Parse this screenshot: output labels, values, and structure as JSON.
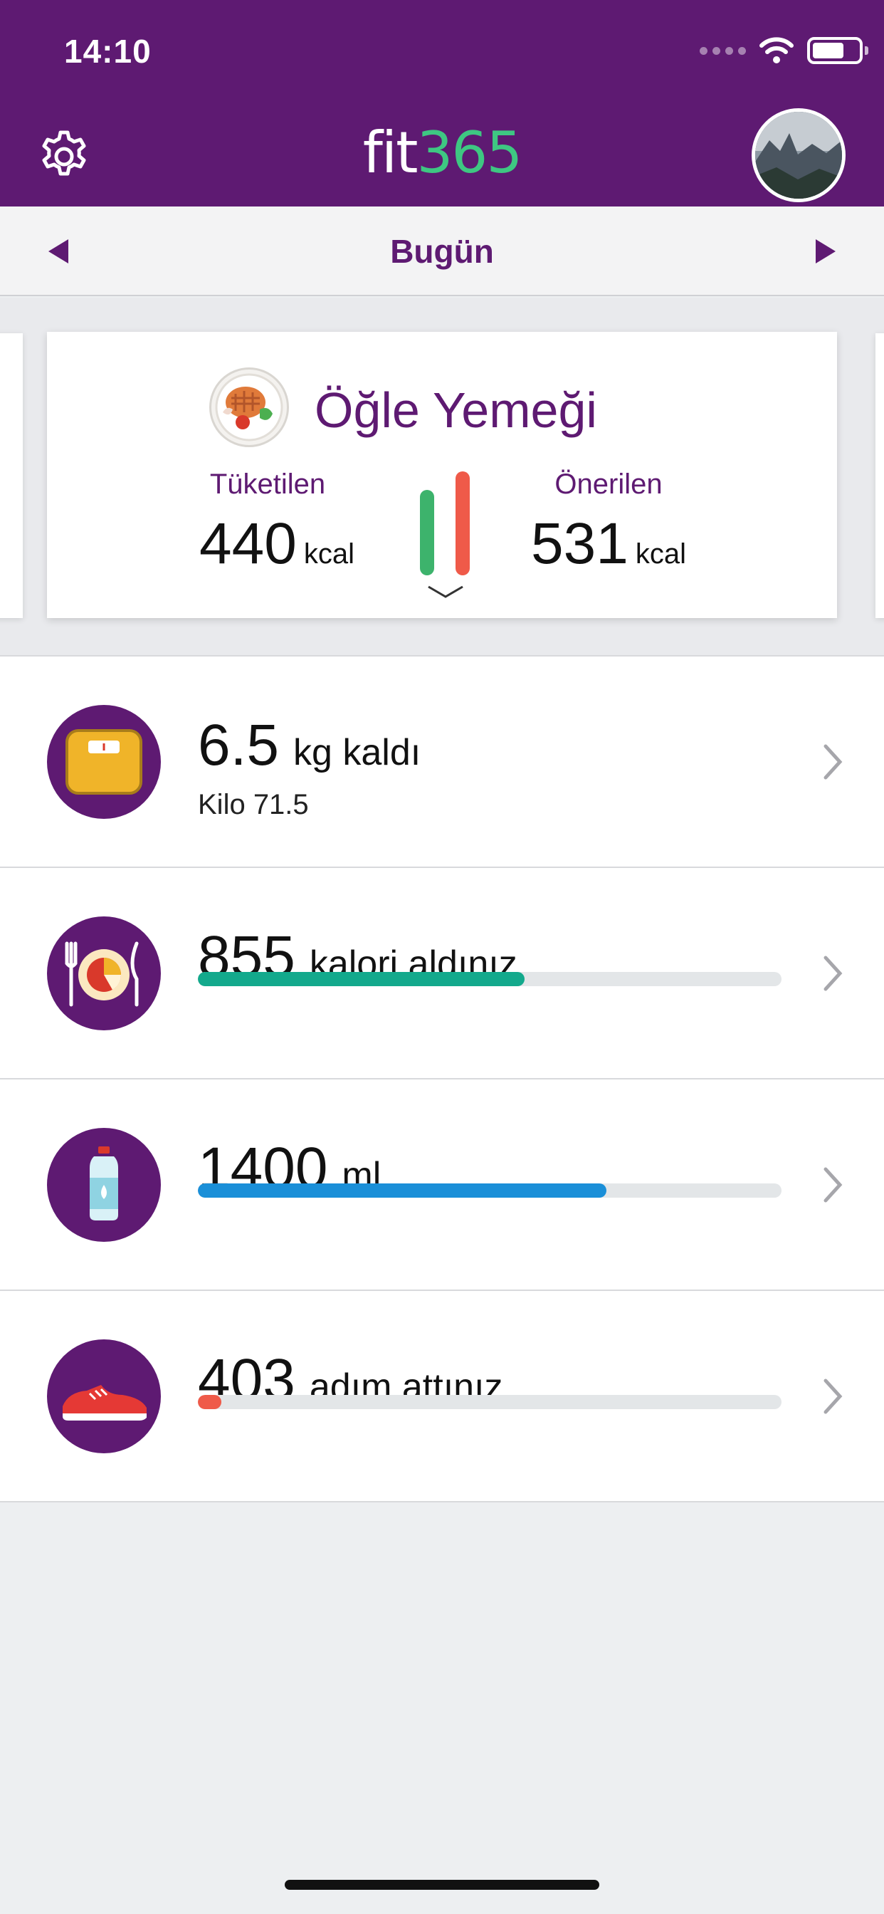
{
  "status_bar": {
    "time": "14:10"
  },
  "header": {
    "logo_fit": "fit",
    "logo_num": "365",
    "settings_icon": "gear-icon",
    "avatar_icon": "profile-photo"
  },
  "date_nav": {
    "label": "Bugün",
    "prev_icon": "triangle-left-icon",
    "next_icon": "triangle-right-icon"
  },
  "meal_card": {
    "title": "Öğle Yemeği",
    "consumed_label": "Tüketilen",
    "consumed_value": "440",
    "consumed_unit": "kcal",
    "recommended_label": "Önerilen",
    "recommended_value": "531",
    "recommended_unit": "kcal",
    "consumed_fraction": 0.83,
    "colors": {
      "consumed": "#3db36c",
      "recommended": "#ef5a49"
    }
  },
  "rows": [
    {
      "id": "weight",
      "icon": "scale-icon",
      "value": "6.5",
      "suffix": "kg kaldı",
      "sub": "Kilo 71.5"
    },
    {
      "id": "calories",
      "icon": "plate-icon",
      "value": "855",
      "suffix": "kalori aldınız",
      "progress": 0.56,
      "color": "#13a98c"
    },
    {
      "id": "water",
      "icon": "water-bottle-icon",
      "value": "1400",
      "suffix": "ml",
      "progress": 0.7,
      "color": "#1a8fd8"
    },
    {
      "id": "steps",
      "icon": "sneaker-icon",
      "value": "403",
      "suffix": "adım attınız",
      "progress": 0.04,
      "color": "#ef5a49"
    }
  ],
  "colors": {
    "brand": "#5e1a72",
    "accent_green": "#3ec782"
  }
}
